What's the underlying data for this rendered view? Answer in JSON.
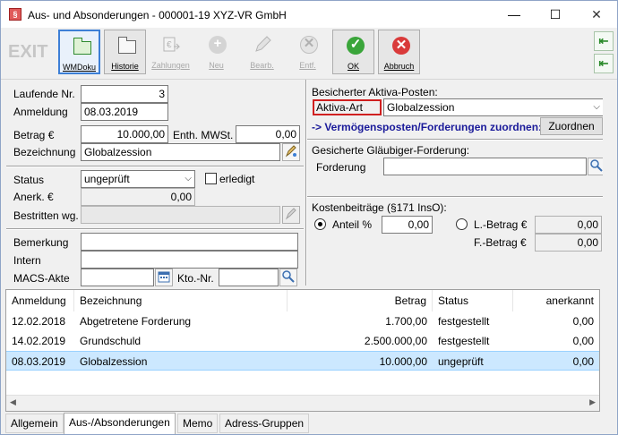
{
  "window": {
    "title": "Aus- und Absonderungen - 000001-19 XYZ-VR GmbH",
    "minimize": "—",
    "maximize": "☐",
    "close": "✕"
  },
  "toolbar": {
    "exit": "EXIT",
    "wmdoku": "WMDoku",
    "historie": "Historie",
    "zahlungen": "Zahlungen",
    "neu": "Neu",
    "bearb": "Bearb.",
    "entf": "Entf.",
    "ok": "OK",
    "abbruch": "Abbruch"
  },
  "form": {
    "laufende_nr_label": "Laufende Nr.",
    "laufende_nr": "3",
    "anmeldung_label": "Anmeldung",
    "anmeldung": "08.03.2019",
    "betrag_label": "Betrag €",
    "betrag": "10.000,00",
    "enth_mwst_label": "Enth. MWSt.",
    "enth_mwst": "0,00",
    "bezeichnung_label": "Bezeichnung",
    "bezeichnung": "Globalzession",
    "status_label": "Status",
    "status": "ungeprüft",
    "erledigt_label": "erledigt",
    "anerk_label": "Anerk. €",
    "anerk": "0,00",
    "bestritten_label": "Bestritten wg.",
    "bestritten": "",
    "bemerkung_label": "Bemerkung",
    "bemerkung": "",
    "intern_label": "Intern",
    "intern": "",
    "macs_label": "MACS-Akte",
    "macs": "",
    "kto_label": "Kto.-Nr.",
    "kto": ""
  },
  "aktiva": {
    "header": "Besicherter Aktiva-Posten:",
    "art_label": "Aktiva-Art",
    "art_value": "Globalzession",
    "zuordnen_link": "-> Vermögensposten/Forderungen zuordnen:",
    "zuordnen_button": "Zuordnen"
  },
  "glaeubiger": {
    "header": "Gesicherte Gläubiger-Forderung:",
    "forderung_label": "Forderung",
    "forderung": ""
  },
  "kosten": {
    "header": "Kostenbeiträge (§171 InsO):",
    "anteil_label": "Anteil %",
    "anteil": "0,00",
    "lbetrag_label": "L.-Betrag €",
    "lbetrag": "0,00",
    "fbetrag_label": "F.-Betrag €",
    "fbetrag": "0,00"
  },
  "table": {
    "columns": [
      "Anmeldung",
      "Bezeichnung",
      "Betrag",
      "Status",
      "anerkannt"
    ],
    "rows": [
      [
        "12.02.2018",
        "Abgetretene Forderung",
        "1.700,00",
        "festgestellt",
        "0,00"
      ],
      [
        "14.02.2019",
        "Grundschuld",
        "2.500.000,00",
        "festgestellt",
        "0,00"
      ],
      [
        "08.03.2019",
        "Globalzession",
        "10.000,00",
        "ungeprüft",
        "0,00"
      ]
    ]
  },
  "tabs": [
    "Allgemein",
    "Aus-/Absonderungen",
    "Memo",
    "Adress-Gruppen"
  ],
  "colors": {
    "accent": "#3c7fd6",
    "selection": "#cce8ff",
    "ok_green": "#3aa53a",
    "cancel_red": "#d93a3a",
    "link_blue": "#1a1a9a"
  }
}
